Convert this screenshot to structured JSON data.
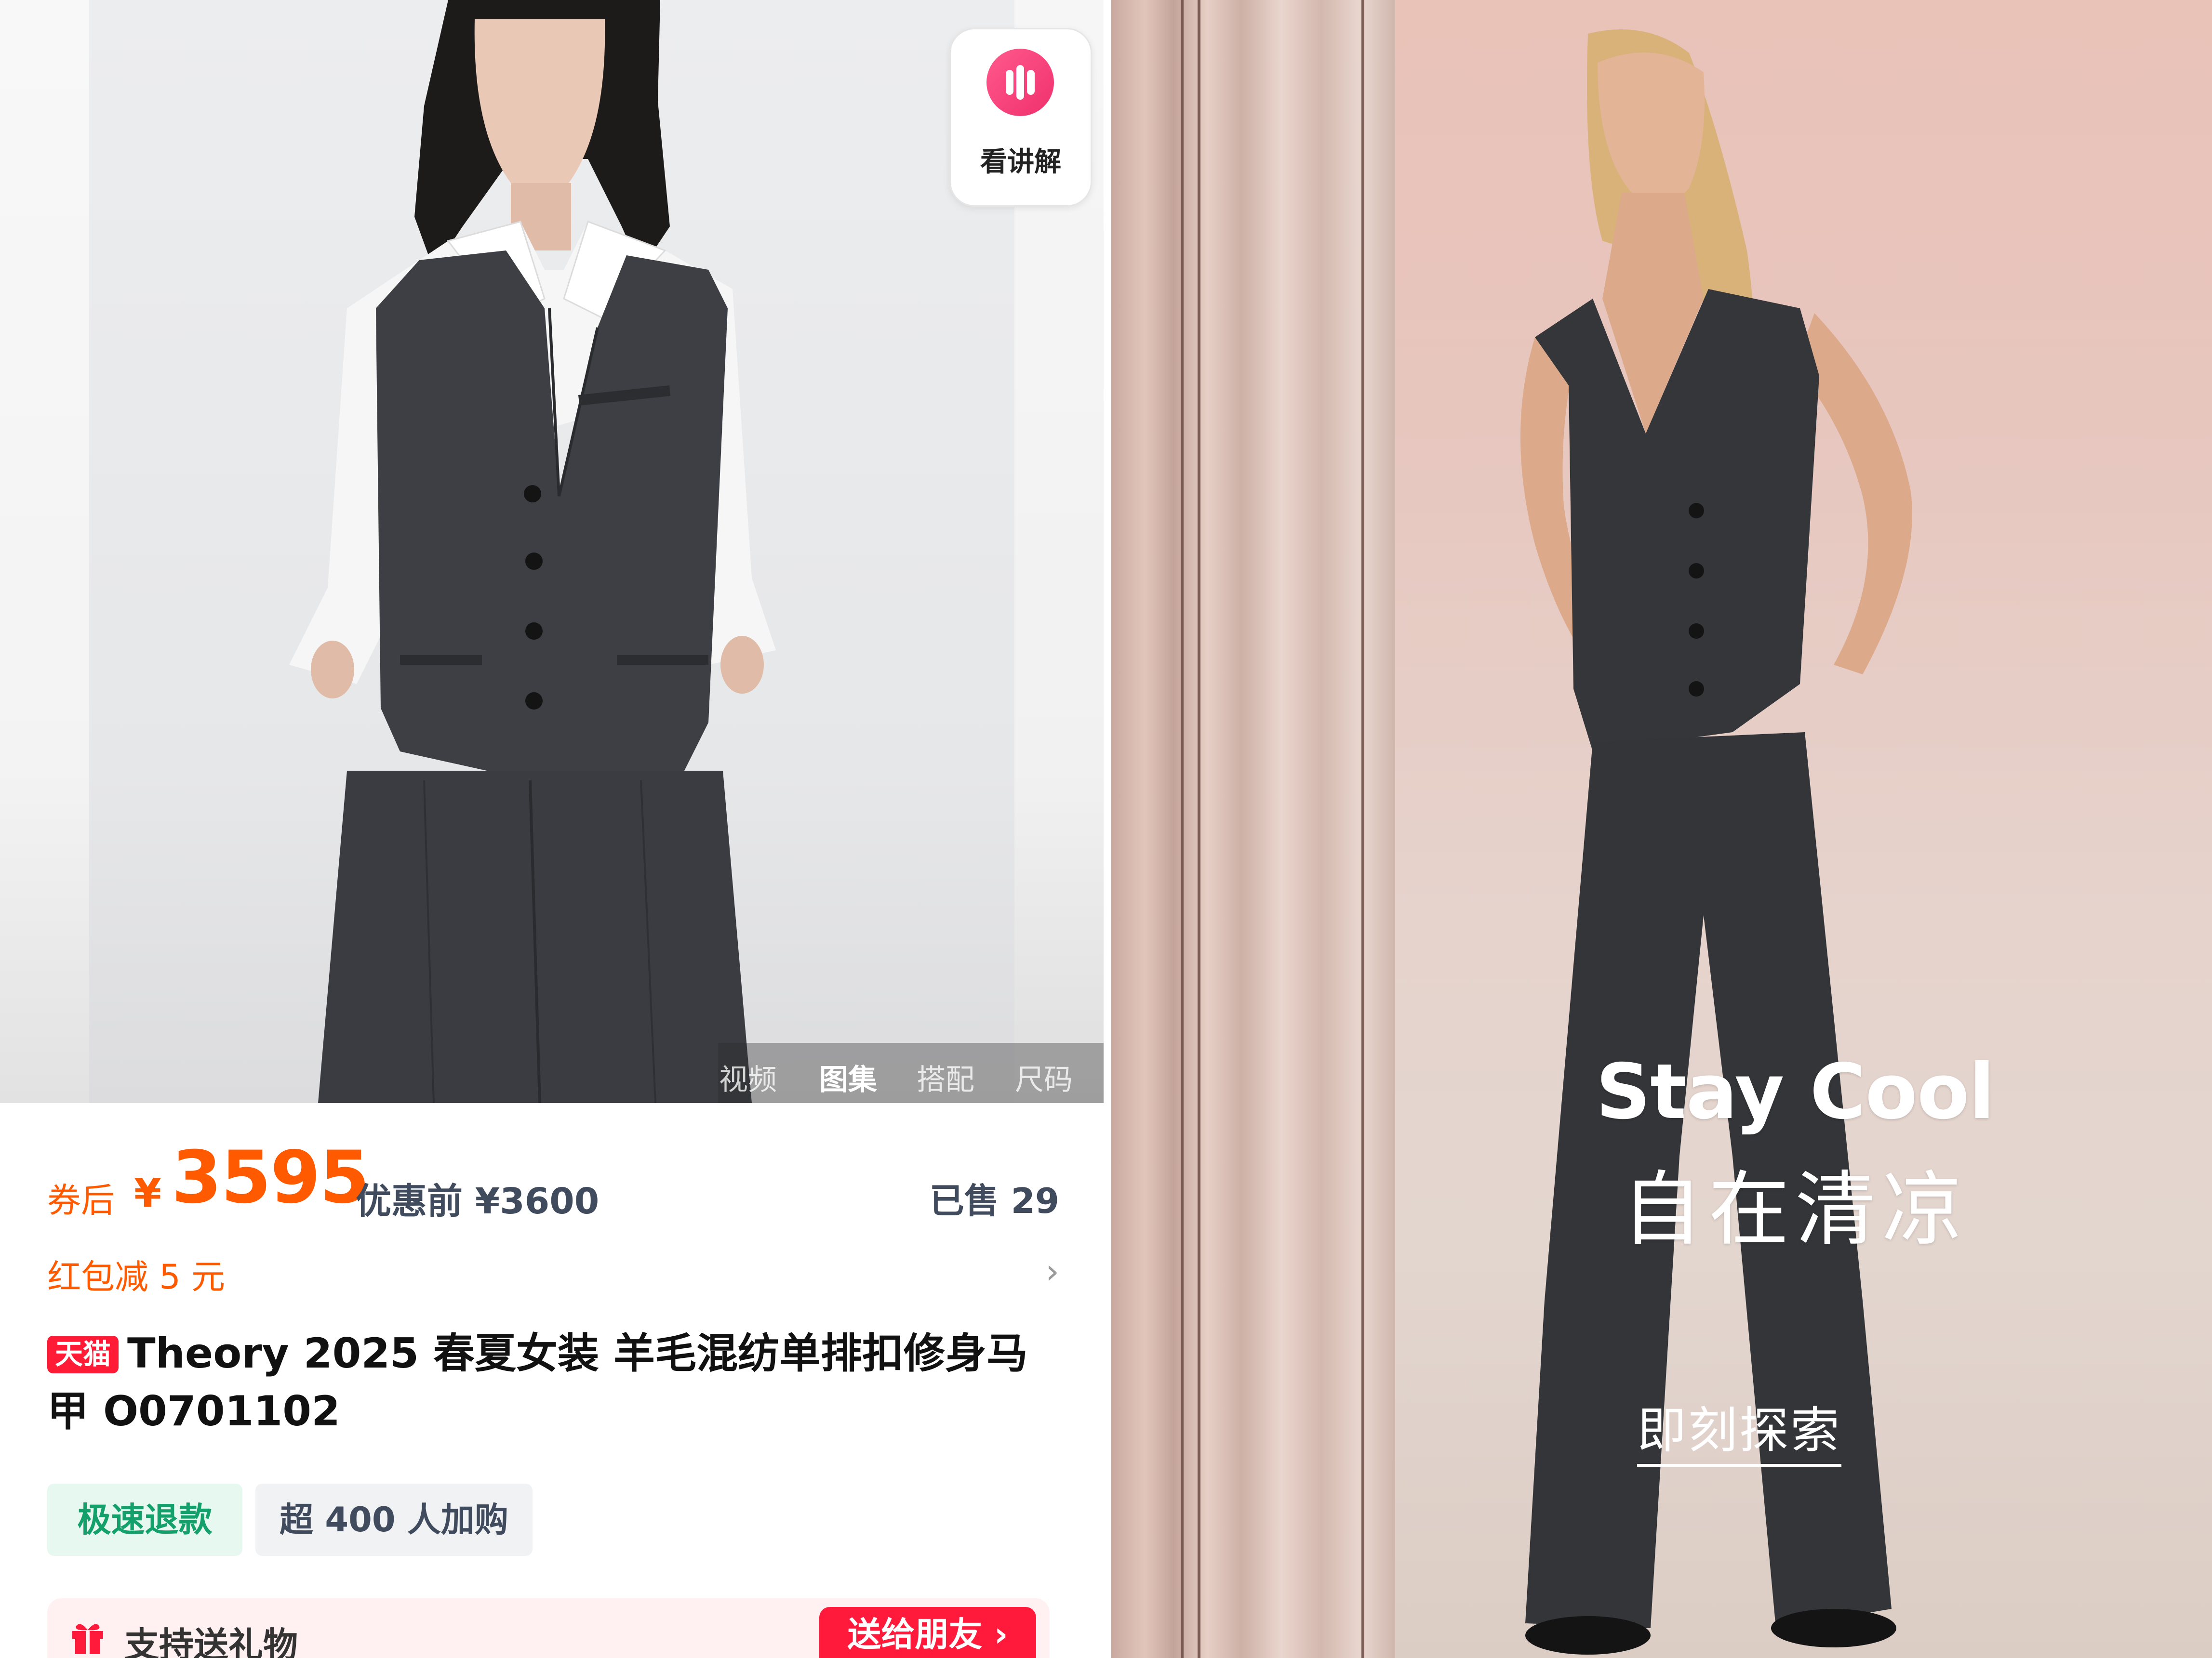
{
  "left": {
    "explain_button": {
      "label": "看讲解",
      "icon": "play-bars-icon"
    },
    "media_tabs": [
      {
        "label": "视频",
        "active": false
      },
      {
        "label": "图集",
        "active": true
      },
      {
        "label": "搭配",
        "active": false
      },
      {
        "label": "尺码",
        "active": false
      }
    ],
    "price": {
      "coupon_label": "券后",
      "currency": "¥",
      "value": "3595",
      "original": "优惠前 ¥3600",
      "sold": "已售 29"
    },
    "red_packet": {
      "label": "红包减 5 元",
      "chevron": "›"
    },
    "product": {
      "badge": "天猫",
      "title": "Theory 2025 春夏女装 羊毛混纺单排扣修身马甲 O0701102"
    },
    "tags": {
      "refund": "极速退款",
      "buyers": "超 400 人加购"
    },
    "gift": {
      "label": "支持送礼物",
      "button": "送给朋友 ›",
      "icon": "gift-icon"
    }
  },
  "right": {
    "headline_en": "Stay Cool",
    "headline_cn": "自在清凉",
    "cta": "即刻探索"
  },
  "colors": {
    "price_orange": "#ff5a00",
    "tmall_red": "#ff1a36",
    "refund_green": "#14a06a",
    "explain_pink": "#f0306e"
  }
}
